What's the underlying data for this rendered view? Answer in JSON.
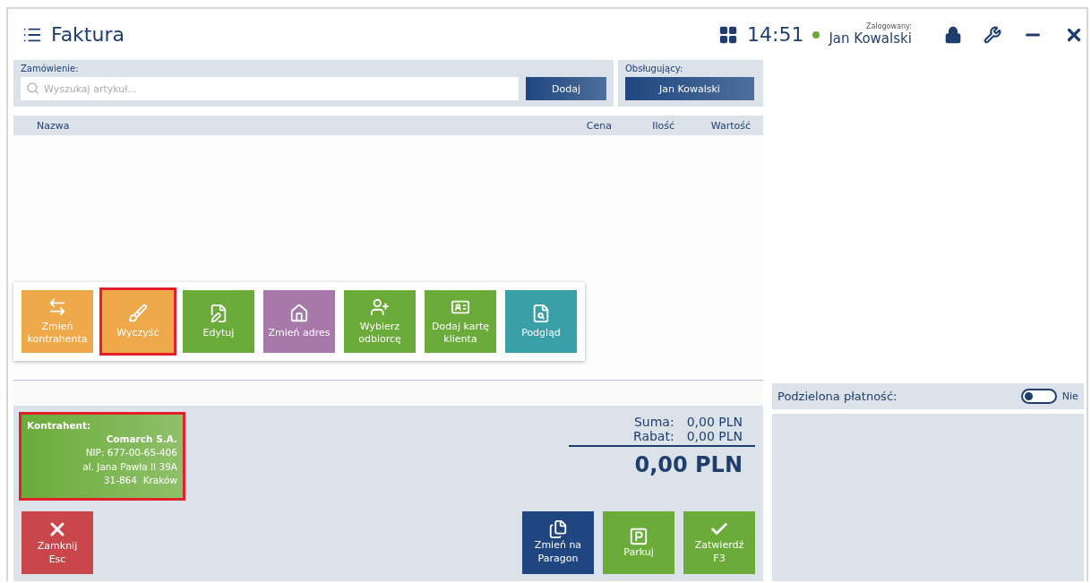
{
  "header": {
    "title": "Faktura",
    "time": "14:51",
    "logged_label": "Zalogowany:",
    "online": true,
    "user": "Jan Kowalski"
  },
  "order": {
    "label": "Zamówienie:",
    "placeholder": "Wyszukaj artykuł...",
    "add_button": "Dodaj"
  },
  "cashier": {
    "label": "Obsługujący:",
    "button": "Jan Kowalski"
  },
  "table": {
    "columns": [
      "Nazwa",
      "Cena",
      "Ilość",
      "Wartość"
    ]
  },
  "action_menu": [
    {
      "label": "Zmień kontrahenta",
      "color": "#f0a94a",
      "highlighted": false
    },
    {
      "label": "Wyczyść",
      "color": "#f0a94a",
      "highlighted": true
    },
    {
      "label": "Edytuj",
      "color": "#6aab3a",
      "highlighted": false
    },
    {
      "label": "Zmień adres",
      "color": "#a779aa",
      "highlighted": false
    },
    {
      "label": "Wybierz odbiorcę",
      "color": "#6aab3a",
      "highlighted": false
    },
    {
      "label": "Dodaj kartę klienta",
      "color": "#6aab3a",
      "highlighted": false
    },
    {
      "label": "Podgląd",
      "color": "#3aa0a8",
      "highlighted": false
    }
  ],
  "contractor": {
    "title": "Kontrahent:",
    "name": "Comarch S.A.",
    "lines": [
      "NIP: 677-00-65-406",
      "al. Jana Pawła II 39A",
      "31-864  Kraków"
    ],
    "highlighted": true
  },
  "totals": {
    "sum_label": "Suma:",
    "sum": "0,00 PLN",
    "discount_label": "Rabat:",
    "discount": "0,00 PLN",
    "total": "0,00 PLN"
  },
  "close_button": {
    "label": "Zamknij",
    "hint": "Esc"
  },
  "action_buttons": [
    {
      "label": "Zmień na Paragon",
      "color": "#1f4680"
    },
    {
      "label": "Parkuj",
      "color": "#6aab3a"
    },
    {
      "label": "Zatwierdź",
      "hint": "F3",
      "color": "#6aab3a"
    }
  ],
  "split_payment": {
    "label": "Podzielona płatność:",
    "on": false,
    "state_label": "Nie"
  }
}
